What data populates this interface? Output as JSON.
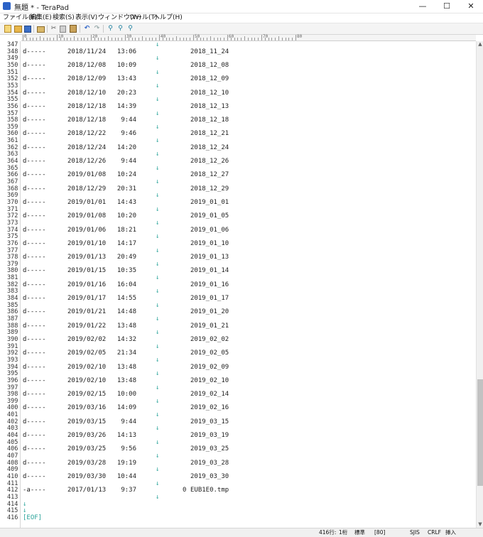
{
  "window": {
    "title": "無題 * - TeraPad"
  },
  "menu": [
    "ファイル(F)",
    "編集(E)",
    "検索(S)",
    "表示(V)",
    "ウィンドウ(W)",
    "ツール(T)",
    "ヘルプ(H)"
  ],
  "ruler": {
    "labels": [
      "0",
      "10",
      "20",
      "30",
      "40",
      "50",
      "60",
      "70",
      "80"
    ]
  },
  "rows": [
    {
      "n": "348",
      "attr": "d-----",
      "date": "2018/11/24",
      "time": "13:06",
      "size": "",
      "name": "2018_11_24"
    },
    {
      "n": "350",
      "attr": "d-----",
      "date": "2018/12/08",
      "time": "10:09",
      "size": "",
      "name": "2018_12_08"
    },
    {
      "n": "352",
      "attr": "d-----",
      "date": "2018/12/09",
      "time": "13:43",
      "size": "",
      "name": "2018_12_09"
    },
    {
      "n": "354",
      "attr": "d-----",
      "date": "2018/12/10",
      "time": "20:23",
      "size": "",
      "name": "2018_12_10"
    },
    {
      "n": "356",
      "attr": "d-----",
      "date": "2018/12/18",
      "time": "14:39",
      "size": "",
      "name": "2018_12_13"
    },
    {
      "n": "358",
      "attr": "d-----",
      "date": "2018/12/18",
      "time": "9:44",
      "size": "",
      "name": "2018_12_18"
    },
    {
      "n": "360",
      "attr": "d-----",
      "date": "2018/12/22",
      "time": "9:46",
      "size": "",
      "name": "2018_12_21"
    },
    {
      "n": "362",
      "attr": "d-----",
      "date": "2018/12/24",
      "time": "14:20",
      "size": "",
      "name": "2018_12_24"
    },
    {
      "n": "364",
      "attr": "d-----",
      "date": "2018/12/26",
      "time": "9:44",
      "size": "",
      "name": "2018_12_26"
    },
    {
      "n": "366",
      "attr": "d-----",
      "date": "2019/01/08",
      "time": "10:24",
      "size": "",
      "name": "2018_12_27"
    },
    {
      "n": "368",
      "attr": "d-----",
      "date": "2018/12/29",
      "time": "20:31",
      "size": "",
      "name": "2018_12_29"
    },
    {
      "n": "370",
      "attr": "d-----",
      "date": "2019/01/01",
      "time": "14:43",
      "size": "",
      "name": "2019_01_01"
    },
    {
      "n": "372",
      "attr": "d-----",
      "date": "2019/01/08",
      "time": "10:20",
      "size": "",
      "name": "2019_01_05"
    },
    {
      "n": "374",
      "attr": "d-----",
      "date": "2019/01/06",
      "time": "18:21",
      "size": "",
      "name": "2019_01_06"
    },
    {
      "n": "376",
      "attr": "d-----",
      "date": "2019/01/10",
      "time": "14:17",
      "size": "",
      "name": "2019_01_10"
    },
    {
      "n": "378",
      "attr": "d-----",
      "date": "2019/01/13",
      "time": "20:49",
      "size": "",
      "name": "2019_01_13"
    },
    {
      "n": "380",
      "attr": "d-----",
      "date": "2019/01/15",
      "time": "10:35",
      "size": "",
      "name": "2019_01_14"
    },
    {
      "n": "382",
      "attr": "d-----",
      "date": "2019/01/16",
      "time": "16:04",
      "size": "",
      "name": "2019_01_16"
    },
    {
      "n": "384",
      "attr": "d-----",
      "date": "2019/01/17",
      "time": "14:55",
      "size": "",
      "name": "2019_01_17"
    },
    {
      "n": "386",
      "attr": "d-----",
      "date": "2019/01/21",
      "time": "14:48",
      "size": "",
      "name": "2019_01_20"
    },
    {
      "n": "388",
      "attr": "d-----",
      "date": "2019/01/22",
      "time": "13:48",
      "size": "",
      "name": "2019_01_21"
    },
    {
      "n": "390",
      "attr": "d-----",
      "date": "2019/02/02",
      "time": "14:32",
      "size": "",
      "name": "2019_02_02"
    },
    {
      "n": "392",
      "attr": "d-----",
      "date": "2019/02/05",
      "time": "21:34",
      "size": "",
      "name": "2019_02_05"
    },
    {
      "n": "394",
      "attr": "d-----",
      "date": "2019/02/10",
      "time": "13:48",
      "size": "",
      "name": "2019_02_09"
    },
    {
      "n": "396",
      "attr": "d-----",
      "date": "2019/02/10",
      "time": "13:48",
      "size": "",
      "name": "2019_02_10"
    },
    {
      "n": "398",
      "attr": "d-----",
      "date": "2019/02/15",
      "time": "10:00",
      "size": "",
      "name": "2019_02_14"
    },
    {
      "n": "400",
      "attr": "d-----",
      "date": "2019/03/16",
      "time": "14:09",
      "size": "",
      "name": "2019_02_16"
    },
    {
      "n": "402",
      "attr": "d-----",
      "date": "2019/03/15",
      "time": "9:44",
      "size": "",
      "name": "2019_03_15"
    },
    {
      "n": "404",
      "attr": "d-----",
      "date": "2019/03/26",
      "time": "14:13",
      "size": "",
      "name": "2019_03_19"
    },
    {
      "n": "406",
      "attr": "d-----",
      "date": "2019/03/25",
      "time": "9:56",
      "size": "",
      "name": "2019_03_25"
    },
    {
      "n": "408",
      "attr": "d-----",
      "date": "2019/03/28",
      "time": "19:19",
      "size": "",
      "name": "2019_03_28"
    },
    {
      "n": "410",
      "attr": "d-----",
      "date": "2019/03/30",
      "time": "10:44",
      "size": "",
      "name": "2019_03_30"
    },
    {
      "n": "412",
      "attr": "-a----",
      "date": "2017/01/13",
      "time": "9:37",
      "size": "0",
      "name": "EUB1E0.tmp"
    }
  ],
  "oddlines": [
    "347",
    "349",
    "351",
    "353",
    "355",
    "357",
    "359",
    "361",
    "363",
    "365",
    "367",
    "369",
    "371",
    "373",
    "375",
    "377",
    "379",
    "381",
    "383",
    "385",
    "387",
    "389",
    "391",
    "393",
    "395",
    "397",
    "399",
    "401",
    "403",
    "405",
    "407",
    "409",
    "411",
    "413",
    "414",
    "415",
    "416"
  ],
  "arrow_glyph": "↓",
  "eof_text": "[EOF]",
  "status": {
    "position": "416行:",
    "col": "1桁",
    "mode": "標準",
    "code": "[80]",
    "encoding": "SJIS",
    "newline": "CRLF",
    "insert": "挿入"
  }
}
